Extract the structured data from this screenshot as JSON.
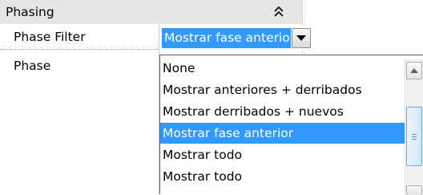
{
  "section": {
    "title": "Phasing",
    "collapse_icon": "double-chevron-up-icon"
  },
  "properties": [
    {
      "name": "Phase Filter",
      "value": "Mostrar fase anterior"
    },
    {
      "name": "Phase",
      "value": ""
    }
  ],
  "combo": {
    "value": "Mostrar fase anterior",
    "button_icon": "chevron-down-icon"
  },
  "dropdown": {
    "options": [
      "None",
      "Mostrar anteriores + derribados",
      "Mostrar derribados + nuevos",
      "Mostrar fase anterior",
      "Mostrar todo",
      "Mostrar todo"
    ],
    "selected_index": 3
  },
  "colors": {
    "selection": "#3399ff",
    "header_bg": "#e6e6e6"
  }
}
